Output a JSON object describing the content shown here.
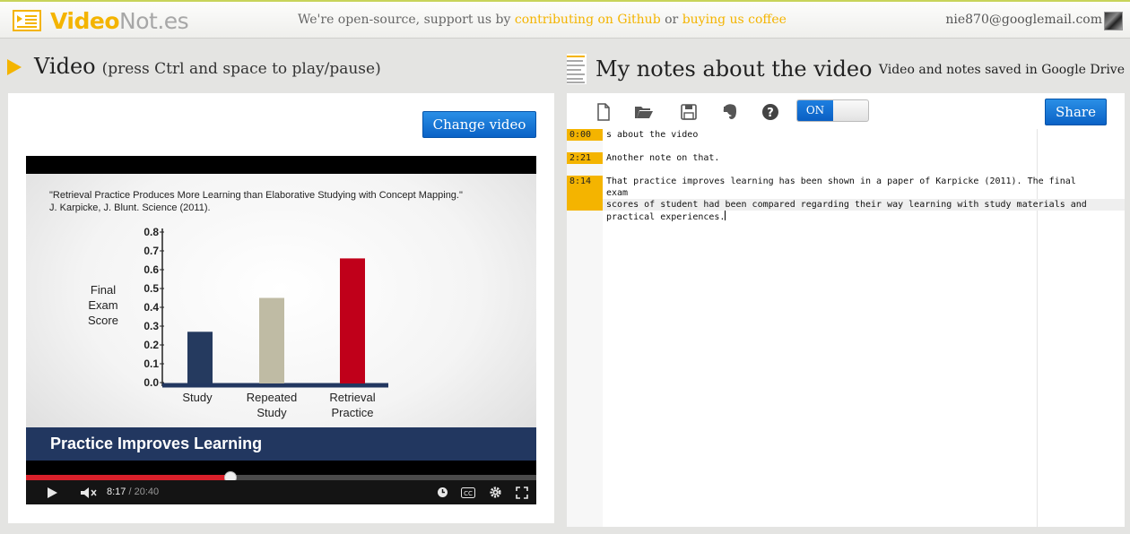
{
  "app": {
    "logo_part1": "Video",
    "logo_part2": "Not.es",
    "tagline_prefix": "We're open-source, support us by ",
    "tagline_link1": "contributing on Github",
    "tagline_mid": " or ",
    "tagline_link2": "buying us coffee",
    "user_email": "nie870@googlemail.com"
  },
  "video_section": {
    "title": "Video",
    "hint": "(press Ctrl and space to play/pause)",
    "change_video_label": "Change video"
  },
  "player": {
    "slide_citation_line1": "\"Retrieval Practice Produces More Learning than Elaborative Studying with Concept Mapping.\"",
    "slide_citation_line2": "J. Karpicke, J. Blunt. Science (2011).",
    "banner": "Practice Improves Learning",
    "current_time": "8:17",
    "total_time": "/ 20:40",
    "progress": 0.4
  },
  "chart_data": {
    "type": "bar",
    "categories": [
      "Study",
      "Repeated\nStudy",
      "Retrieval\nPractice"
    ],
    "values": [
      0.27,
      0.45,
      0.66
    ],
    "colors": [
      "#253a5f",
      "#bfbba4",
      "#c0001a"
    ],
    "ylabel": "Final\nExam\nScore",
    "ylim": [
      0,
      0.8
    ],
    "yticks": [
      "0.0",
      "0.1",
      "0.2",
      "0.3",
      "0.4",
      "0.5",
      "0.6",
      "0.7",
      "0.8"
    ]
  },
  "notes_section": {
    "title": "My notes about the video",
    "saved_msg": "Video and notes saved in Google Drive",
    "toggle_label": "ON",
    "share_label": "Share"
  },
  "toolbar_icons": [
    "new-file-icon",
    "open-folder-icon",
    "save-icon",
    "evernote-icon",
    "help-icon"
  ],
  "notes": [
    {
      "time": "0:00",
      "text": "s about the video"
    },
    {
      "time": "2:21",
      "text": "Another note on that."
    },
    {
      "time": "8:14",
      "text": "That practice improves learning has been shown in a paper of Karpicke (2011). The final exam\nscores of student had been compared regarding their way learning with study materials and\npractical experiences."
    }
  ],
  "colors": {
    "accent": "#f4b400",
    "button_blue": "#0a62c6",
    "progress_red": "#d9202a"
  }
}
